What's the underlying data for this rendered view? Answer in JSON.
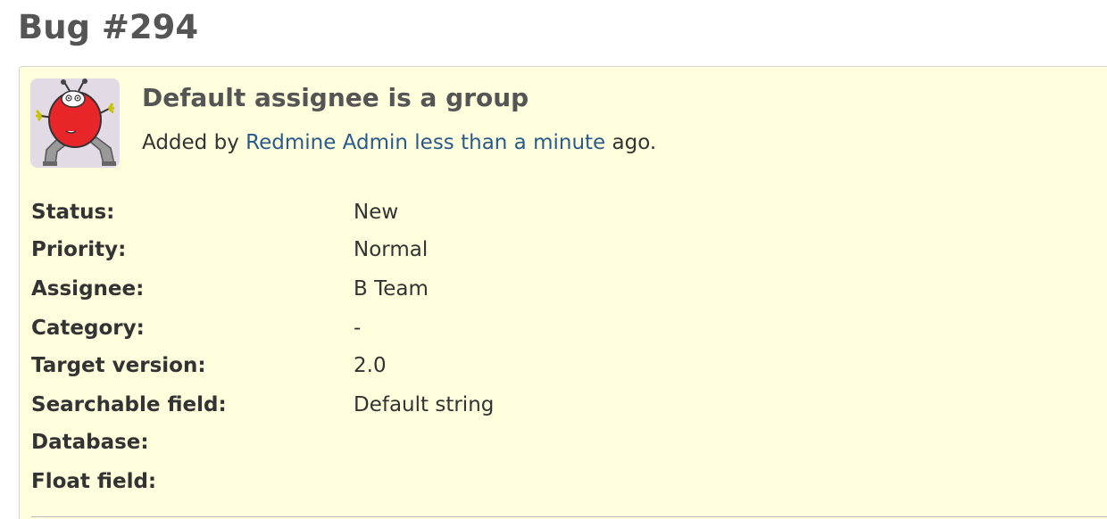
{
  "issue": {
    "title": "Bug #294",
    "subject": "Default assignee is a group",
    "author_prefix": "Added by",
    "author_name": "Redmine Admin",
    "time_ago": "less than a minute",
    "author_suffix": "ago."
  },
  "attributes": [
    {
      "label": "Status:",
      "value": "New"
    },
    {
      "label": "Priority:",
      "value": "Normal"
    },
    {
      "label": "Assignee:",
      "value": "B Team"
    },
    {
      "label": "Category:",
      "value": "-"
    },
    {
      "label": "Target version:",
      "value": "2.0"
    },
    {
      "label": "Searchable field:",
      "value": "Default string"
    },
    {
      "label": "Database:",
      "value": ""
    },
    {
      "label": "Float field:",
      "value": ""
    }
  ],
  "colors": {
    "box_background": "#ffffdd",
    "link": "#2a5a8a",
    "heading": "#555555"
  },
  "icons": {
    "avatar": "bug-mascot-avatar"
  }
}
